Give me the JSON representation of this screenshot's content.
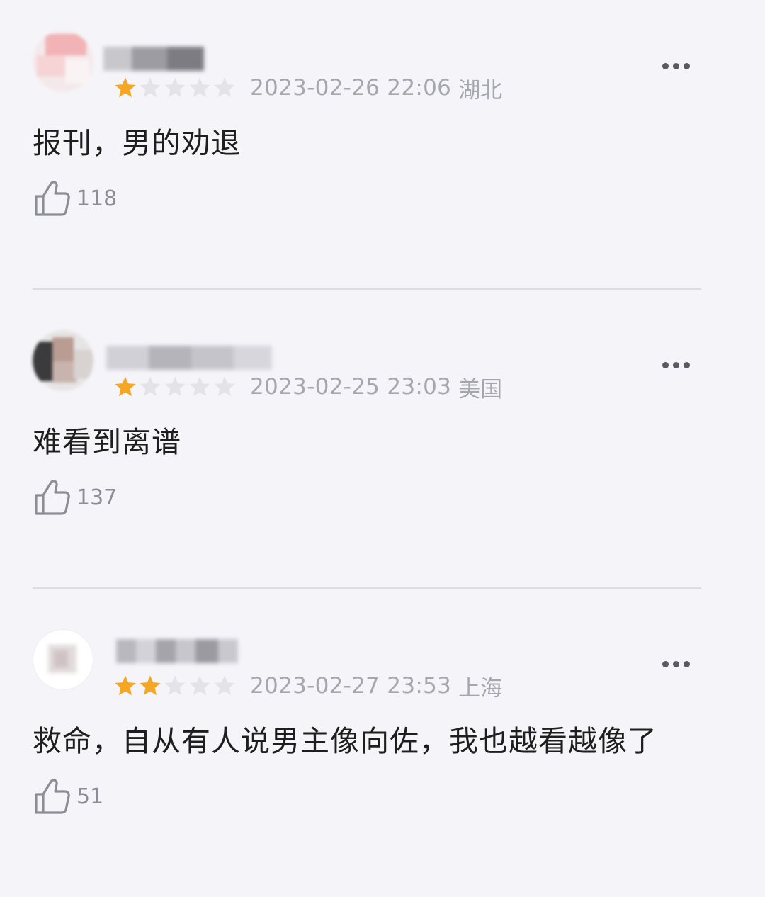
{
  "comments": [
    {
      "rating": 1,
      "max_rating": 5,
      "timestamp": "2023-02-26 22:06",
      "location": "湖北",
      "text": "报刊，男的劝退",
      "likes": "118"
    },
    {
      "rating": 1,
      "max_rating": 5,
      "timestamp": "2023-02-25 23:03",
      "location": "美国",
      "text": "难看到离谱",
      "likes": "137"
    },
    {
      "rating": 2,
      "max_rating": 5,
      "timestamp": "2023-02-27 23:53",
      "location": "上海",
      "text": "救命，自从有人说男主像向佐，我也越看越像了",
      "likes": "51"
    }
  ],
  "colors": {
    "star_filled": "#f5a623",
    "star_empty": "#e3e3e8",
    "meta_text": "#a6a6ad",
    "background": "#f5f5f9"
  },
  "icons": {
    "star": "star-icon",
    "more": "more-options-icon",
    "like": "thumbs-up-icon"
  }
}
